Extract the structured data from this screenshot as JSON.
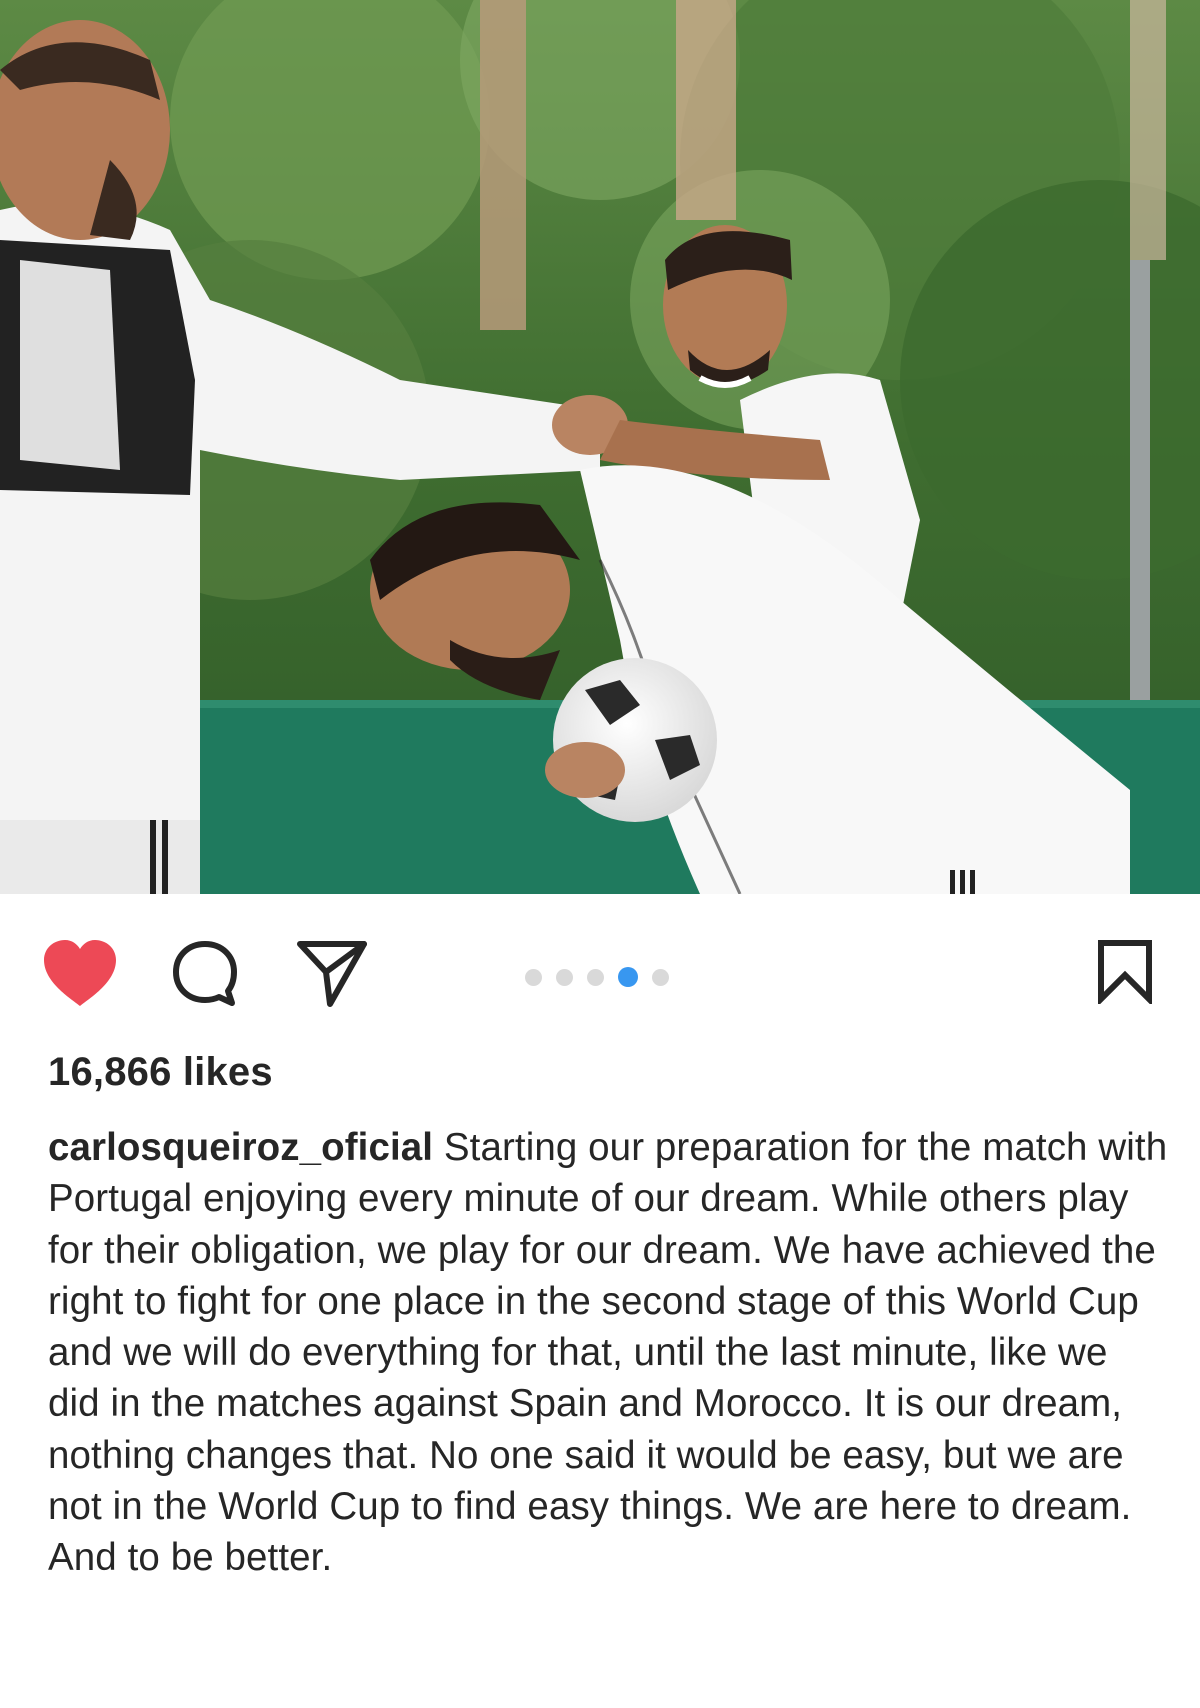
{
  "post": {
    "photo": {
      "description_icon": "photo-image",
      "carousel": {
        "count": 5,
        "active_index": 3
      }
    },
    "actions": {
      "like_icon": "heart-filled-icon",
      "like_color": "#ed4956",
      "comment_icon": "comment-bubble-icon",
      "share_icon": "paper-plane-icon",
      "save_icon": "bookmark-icon",
      "carousel_active_color": "#3897f0"
    },
    "likes_text": "16,866 likes",
    "caption": {
      "username": "carlosqueiroz_oficial",
      "text": "Starting our preparation for the match with Portugal enjoying every minute of our dream. While others play for their obligation, we play for our dream. We have achieved the right to fight for one place in the second stage of this World Cup and we will do everything for that, until the last minute, like we did in the matches against Spain and Morocco. It is our dream, nothing changes that. No one said it would be easy, but we are not in the World Cup to find easy things. We are here to dream. And to be better."
    }
  }
}
